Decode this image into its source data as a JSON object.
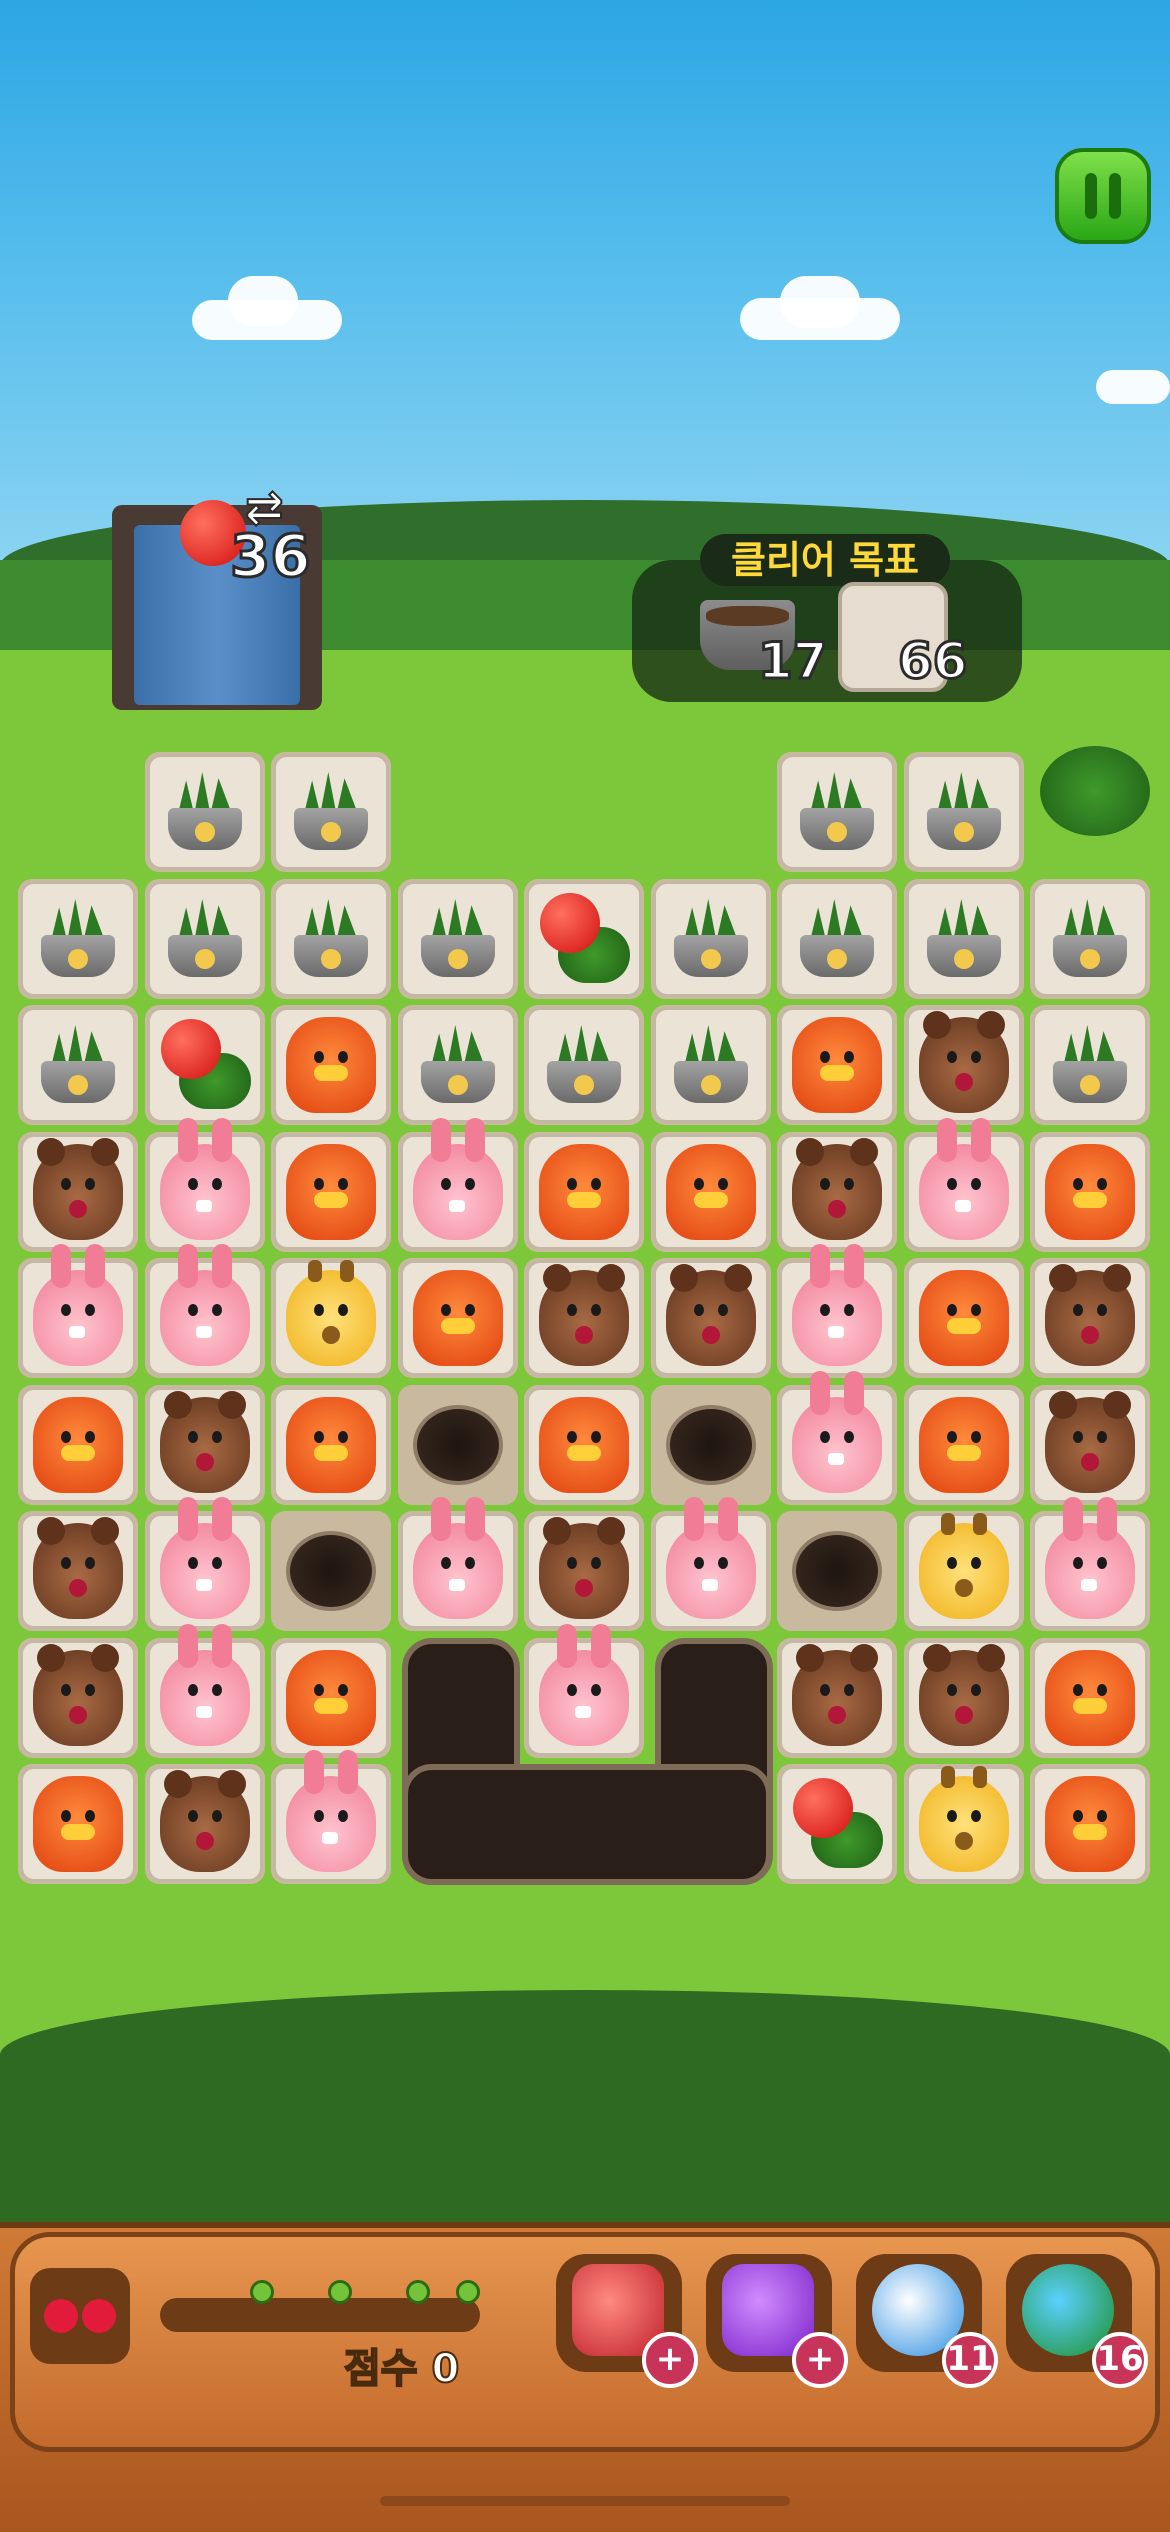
{
  "hud": {
    "moves_remaining": "36",
    "swap_icon": "⇄",
    "apple_icon": "apple-icon",
    "goal_title": "클리어 목표",
    "goals": [
      {
        "icon": "flowerpot-icon",
        "count": "17"
      },
      {
        "icon": "stone-tile-icon",
        "count": "66"
      }
    ],
    "pause_icon": "pause-icon"
  },
  "board": {
    "rows": [
      [
        "empty",
        "pot",
        "pot",
        "empty",
        "empty",
        "empty",
        "pot",
        "pot",
        "bush"
      ],
      [
        "pot",
        "pot",
        "pot",
        "pot",
        "apple",
        "pot",
        "pot",
        "pot",
        "pot"
      ],
      [
        "pot",
        "apple",
        "duck",
        "pot",
        "pot",
        "pot",
        "duck",
        "bear",
        "pot"
      ],
      [
        "bear",
        "rabbit",
        "duck",
        "rabbit",
        "duck",
        "duck",
        "bear",
        "rabbit",
        "duck"
      ],
      [
        "rabbit",
        "rabbit",
        "giraffe",
        "duck",
        "bear",
        "bear",
        "rabbit",
        "duck",
        "bear"
      ],
      [
        "duck",
        "bear",
        "duck",
        "hole",
        "duck",
        "hole",
        "rabbit",
        "duck",
        "bear"
      ],
      [
        "bear",
        "rabbit",
        "hole",
        "rabbit",
        "bear",
        "rabbit",
        "hole",
        "giraffe",
        "rabbit"
      ],
      [
        "bear",
        "rabbit",
        "duck",
        "bighole",
        "rabbit",
        "bighole",
        "bear",
        "bear",
        "duck"
      ],
      [
        "duck",
        "bear",
        "rabbit",
        "bighole",
        "bighole",
        "bighole",
        "apple",
        "giraffe",
        "duck"
      ]
    ]
  },
  "bottom": {
    "cherry_icon": "cherry-icon",
    "score_label": "점수 0",
    "boosters": [
      {
        "icon": "hammer-icon",
        "badge": "+"
      },
      {
        "icon": "magic-hammer-icon",
        "badge": "+"
      },
      {
        "icon": "ball-icon",
        "badge": "11"
      },
      {
        "icon": "shuffle-icon",
        "badge": "16"
      }
    ]
  },
  "colors": {
    "sky": "#2ca6e4",
    "grass": "#7cc73a",
    "wood": "#c36a2c",
    "badge": "#c8335a"
  }
}
